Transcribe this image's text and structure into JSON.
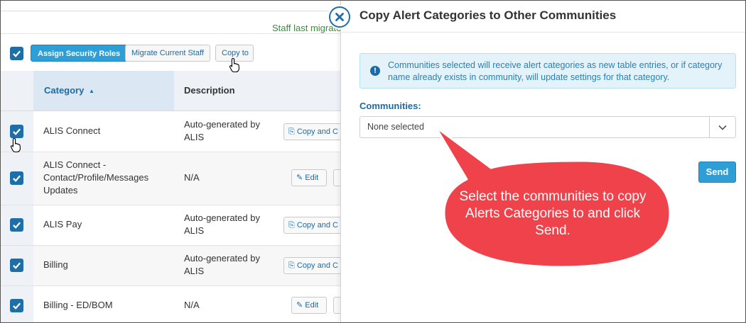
{
  "background": {
    "staff_message": "Staff last migrated",
    "toolbar": {
      "assign_label": "Assign Security Roles",
      "migrate_label": "Migrate Current Staff",
      "copy_label": "Copy to"
    },
    "table": {
      "headers": {
        "category": "Category",
        "sort_indicator": "▲",
        "description": "Description"
      },
      "rows": [
        {
          "category": "ALIS Connect",
          "description": "Auto-generated by ALIS",
          "action": "Copy and C",
          "checked": true
        },
        {
          "category": "ALIS Connect - Contact/Profile/Messages Updates",
          "description": "N/A",
          "action": "Edit",
          "checked": true
        },
        {
          "category": "ALIS Pay",
          "description": "Auto-generated by ALIS",
          "action": "Copy and C",
          "checked": true
        },
        {
          "category": "Billing",
          "description": "Auto-generated by ALIS",
          "action": "Copy and C",
          "checked": true
        },
        {
          "category": "Billing - ED/BOM",
          "description": "N/A",
          "action": "Edit",
          "checked": true
        }
      ]
    }
  },
  "modal": {
    "title": "Copy Alert Categories to Other Communities",
    "close_icon": "close-icon",
    "alert_icon": "exclamation-icon",
    "alert_text": "Communities selected will receive alert categories as new table entries, or if category name already exists in community, will update settings for that category.",
    "communities_label": "Communities:",
    "communities_value": "None selected",
    "send_label": "Send"
  },
  "callout": {
    "text": "Select the communities to copy Alerts Categories to and click Send."
  },
  "colors": {
    "primary": "#2d9fd6",
    "link": "#1a6ba8",
    "callout": "#f0424a",
    "success_text": "#3c8b3c"
  }
}
